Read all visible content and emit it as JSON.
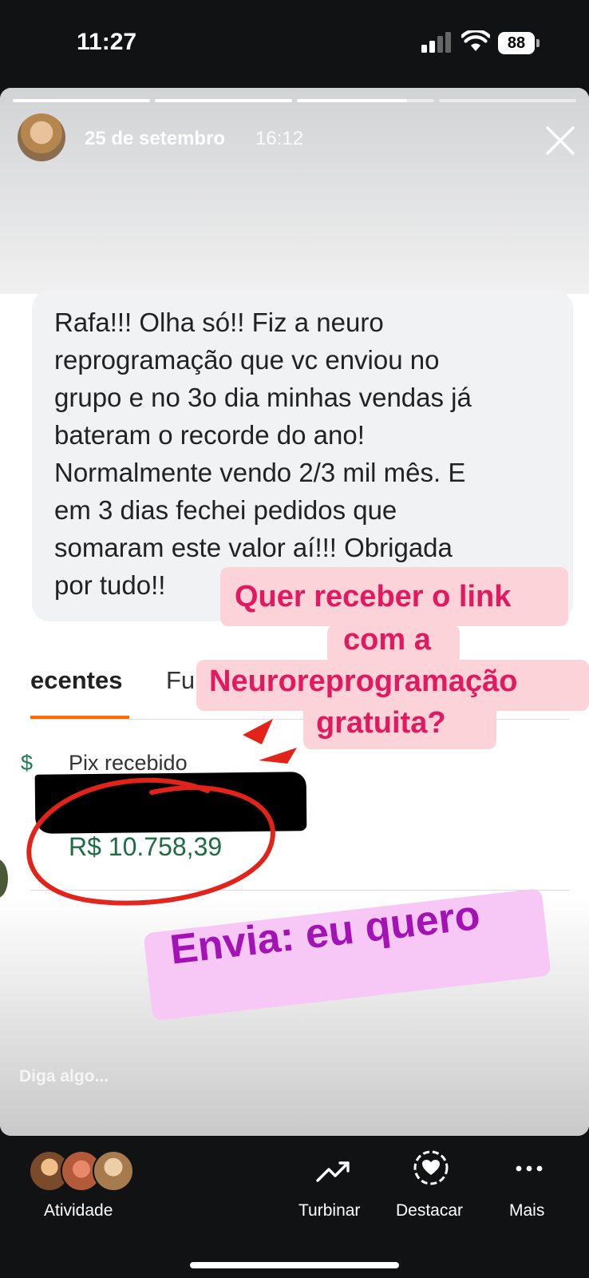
{
  "status_bar": {
    "time": "11:27",
    "battery": "88"
  },
  "story": {
    "date": "25 de setembro",
    "time": "16:12",
    "progress_segments": 4,
    "message_lines": [
      "Rafa!!! Olha só!! Fiz a neuro",
      "reprogramação que vc enviou no",
      "grupo e no 3o dia minhas vendas já",
      "bateram o recorde do ano!",
      "Normalmente vendo 2/3 mil mês. E",
      "em 3 dias fechei pedidos que",
      "somaram este valor aí!!! Obrigada",
      "por tudo!!"
    ],
    "bank": {
      "tab_recentes": "ecentes",
      "tab_fu": "Fu",
      "pix_left": "$",
      "pix_label": "Pix recebido",
      "amount": "R$ 10.758,39"
    },
    "sticker_lines": [
      "Quer receber o link",
      "com a",
      "Neuroreprogramação",
      "gratuita?"
    ],
    "envia": "Envia: eu quero",
    "reply_placeholder": "Diga algo..."
  },
  "bottom_nav": {
    "atividade": "Atividade",
    "turbinar": "Turbinar",
    "destacar": "Destacar",
    "mais": "Mais"
  },
  "colors": {
    "accent_pink_text": "#e4185e",
    "envia_text": "#a212b5",
    "amount_green": "#1e6b44",
    "tab_orange": "#ff6b00"
  }
}
